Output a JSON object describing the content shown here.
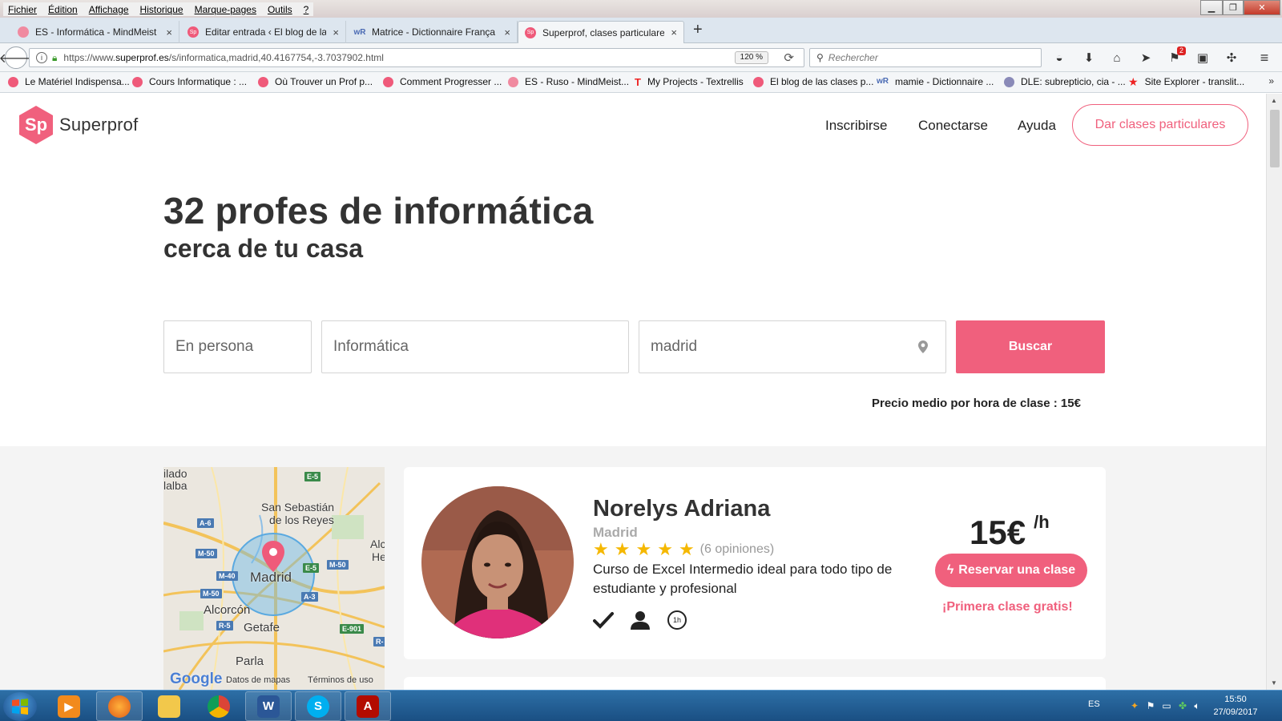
{
  "menubar": {
    "items": [
      "Fichier",
      "Édition",
      "Affichage",
      "Historique",
      "Marque-pages",
      "Outils",
      "?"
    ]
  },
  "tabs": [
    {
      "title": "ES - Informática - MindMeist",
      "close": "×"
    },
    {
      "title": "Editar entrada ‹ El blog de las",
      "close": "×"
    },
    {
      "title": "Matrice - Dictionnaire França",
      "close": "×"
    },
    {
      "title": "Superprof, clases particulares",
      "close": "×",
      "active": true
    }
  ],
  "new_tab": "+",
  "navbar": {
    "url_prefix": "https://www.",
    "url_domain": "superprof.es",
    "url_path": "/s/informatica,madrid,40.4167754,-3.7037902.html",
    "zoom": "120 %",
    "search_placeholder": "Rechercher",
    "notification_count": "2"
  },
  "bookmarks": [
    "Le Matériel Indispensa...",
    "Cours Informatique : ...",
    "Où Trouver un Prof p...",
    "Comment Progresser ...",
    "ES - Ruso - MindMeist...",
    "My Projects - Textrellis",
    "El blog de las clases p...",
    "mamie - Dictionnaire ...",
    "DLE: subrepticio, cia - ...",
    "Site Explorer - translit..."
  ],
  "bookmarks_more": "»",
  "site": {
    "logo_mark": "Sp",
    "logo_text": "Superprof",
    "nav": [
      "Inscribirse",
      "Conectarse",
      "Ayuda"
    ],
    "cta": "Dar clases particulares",
    "brand_color": "#f0607d"
  },
  "hero": {
    "title": "32 profes de informática",
    "subtitle": "cerca de tu casa"
  },
  "search": {
    "mode": "En persona",
    "subject": "Informática",
    "location": "madrid",
    "button": "Buscar",
    "avg_price": "Precio medio por hora de clase : 15€"
  },
  "map": {
    "labels": [
      "ilado",
      "lalba",
      "San Sebastián",
      "de los Reyes",
      "Alc",
      "He",
      "Madrid",
      "Alcorcón",
      "Getafe",
      "Parla"
    ],
    "roads": [
      "E-5",
      "A-6",
      "M-50",
      "M-40",
      "E-5",
      "M-50",
      "M-50",
      "A-3",
      "R-5",
      "E-901",
      "R-"
    ],
    "google": "Google",
    "data_label": "Datos de mapas",
    "terms": "Términos de uso"
  },
  "teacher": {
    "name": "Norelys Adriana",
    "city": "Madrid",
    "rating": 5,
    "reviews": "(6 opiniones)",
    "description": "Curso de Excel Intermedio ideal para todo tipo de estudiante y profesional",
    "price": "15€",
    "price_unit": "/h",
    "book": "Reservar una clase",
    "first_free": "¡Primera clase gratis!",
    "feature_hour": "1h"
  },
  "taskbar": {
    "lang": "ES",
    "time": "15:50",
    "date": "27/09/2017"
  }
}
